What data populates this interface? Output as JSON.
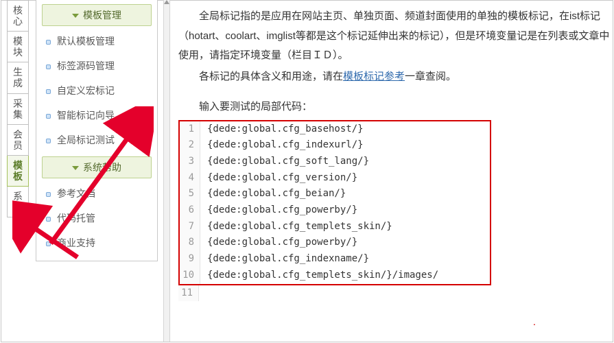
{
  "tabs": {
    "items": [
      "核心",
      "模块",
      "生成",
      "采集",
      "会员",
      "模板",
      "系统"
    ],
    "active_index": 5
  },
  "sidebar": {
    "groups": [
      {
        "title": "模板管理",
        "items": [
          "默认模板管理",
          "标签源码管理",
          "自定义宏标记",
          "智能标记向导",
          "全局标记测试"
        ]
      },
      {
        "title": "系统帮助",
        "items": [
          "参考文档",
          "代码托管",
          "商业支持"
        ]
      }
    ]
  },
  "content": {
    "para1": "全局标记指的是应用在网站主页、单独页面、频道封面使用的单独的模板标记，在ist标记（hotart、coolart、imglist等都是这个标记延伸出来的标记），但是环境变量记是在列表或文章中使用，请指定环境变量（栏目ＩＤ）。",
    "para2_prefix": "各标记的具体含义和用途，请在",
    "para2_link": "模板标记参考",
    "para2_suffix": "一章查阅。",
    "label": "输入要测试的局部代码：",
    "code": [
      "{dede:global.cfg_basehost/}",
      "{dede:global.cfg_indexurl/}",
      "{dede:global.cfg_soft_lang/}",
      "{dede:global.cfg_version/}",
      "{dede:global.cfg_beian/}",
      "{dede:global.cfg_powerby/}",
      "{dede:global.cfg_templets_skin/}",
      "{dede:global.cfg_powerby/}",
      "{dede:global.cfg_indexname/}",
      "{dede:global.cfg_templets_skin/}/images/"
    ],
    "extra_line_number": "11"
  }
}
